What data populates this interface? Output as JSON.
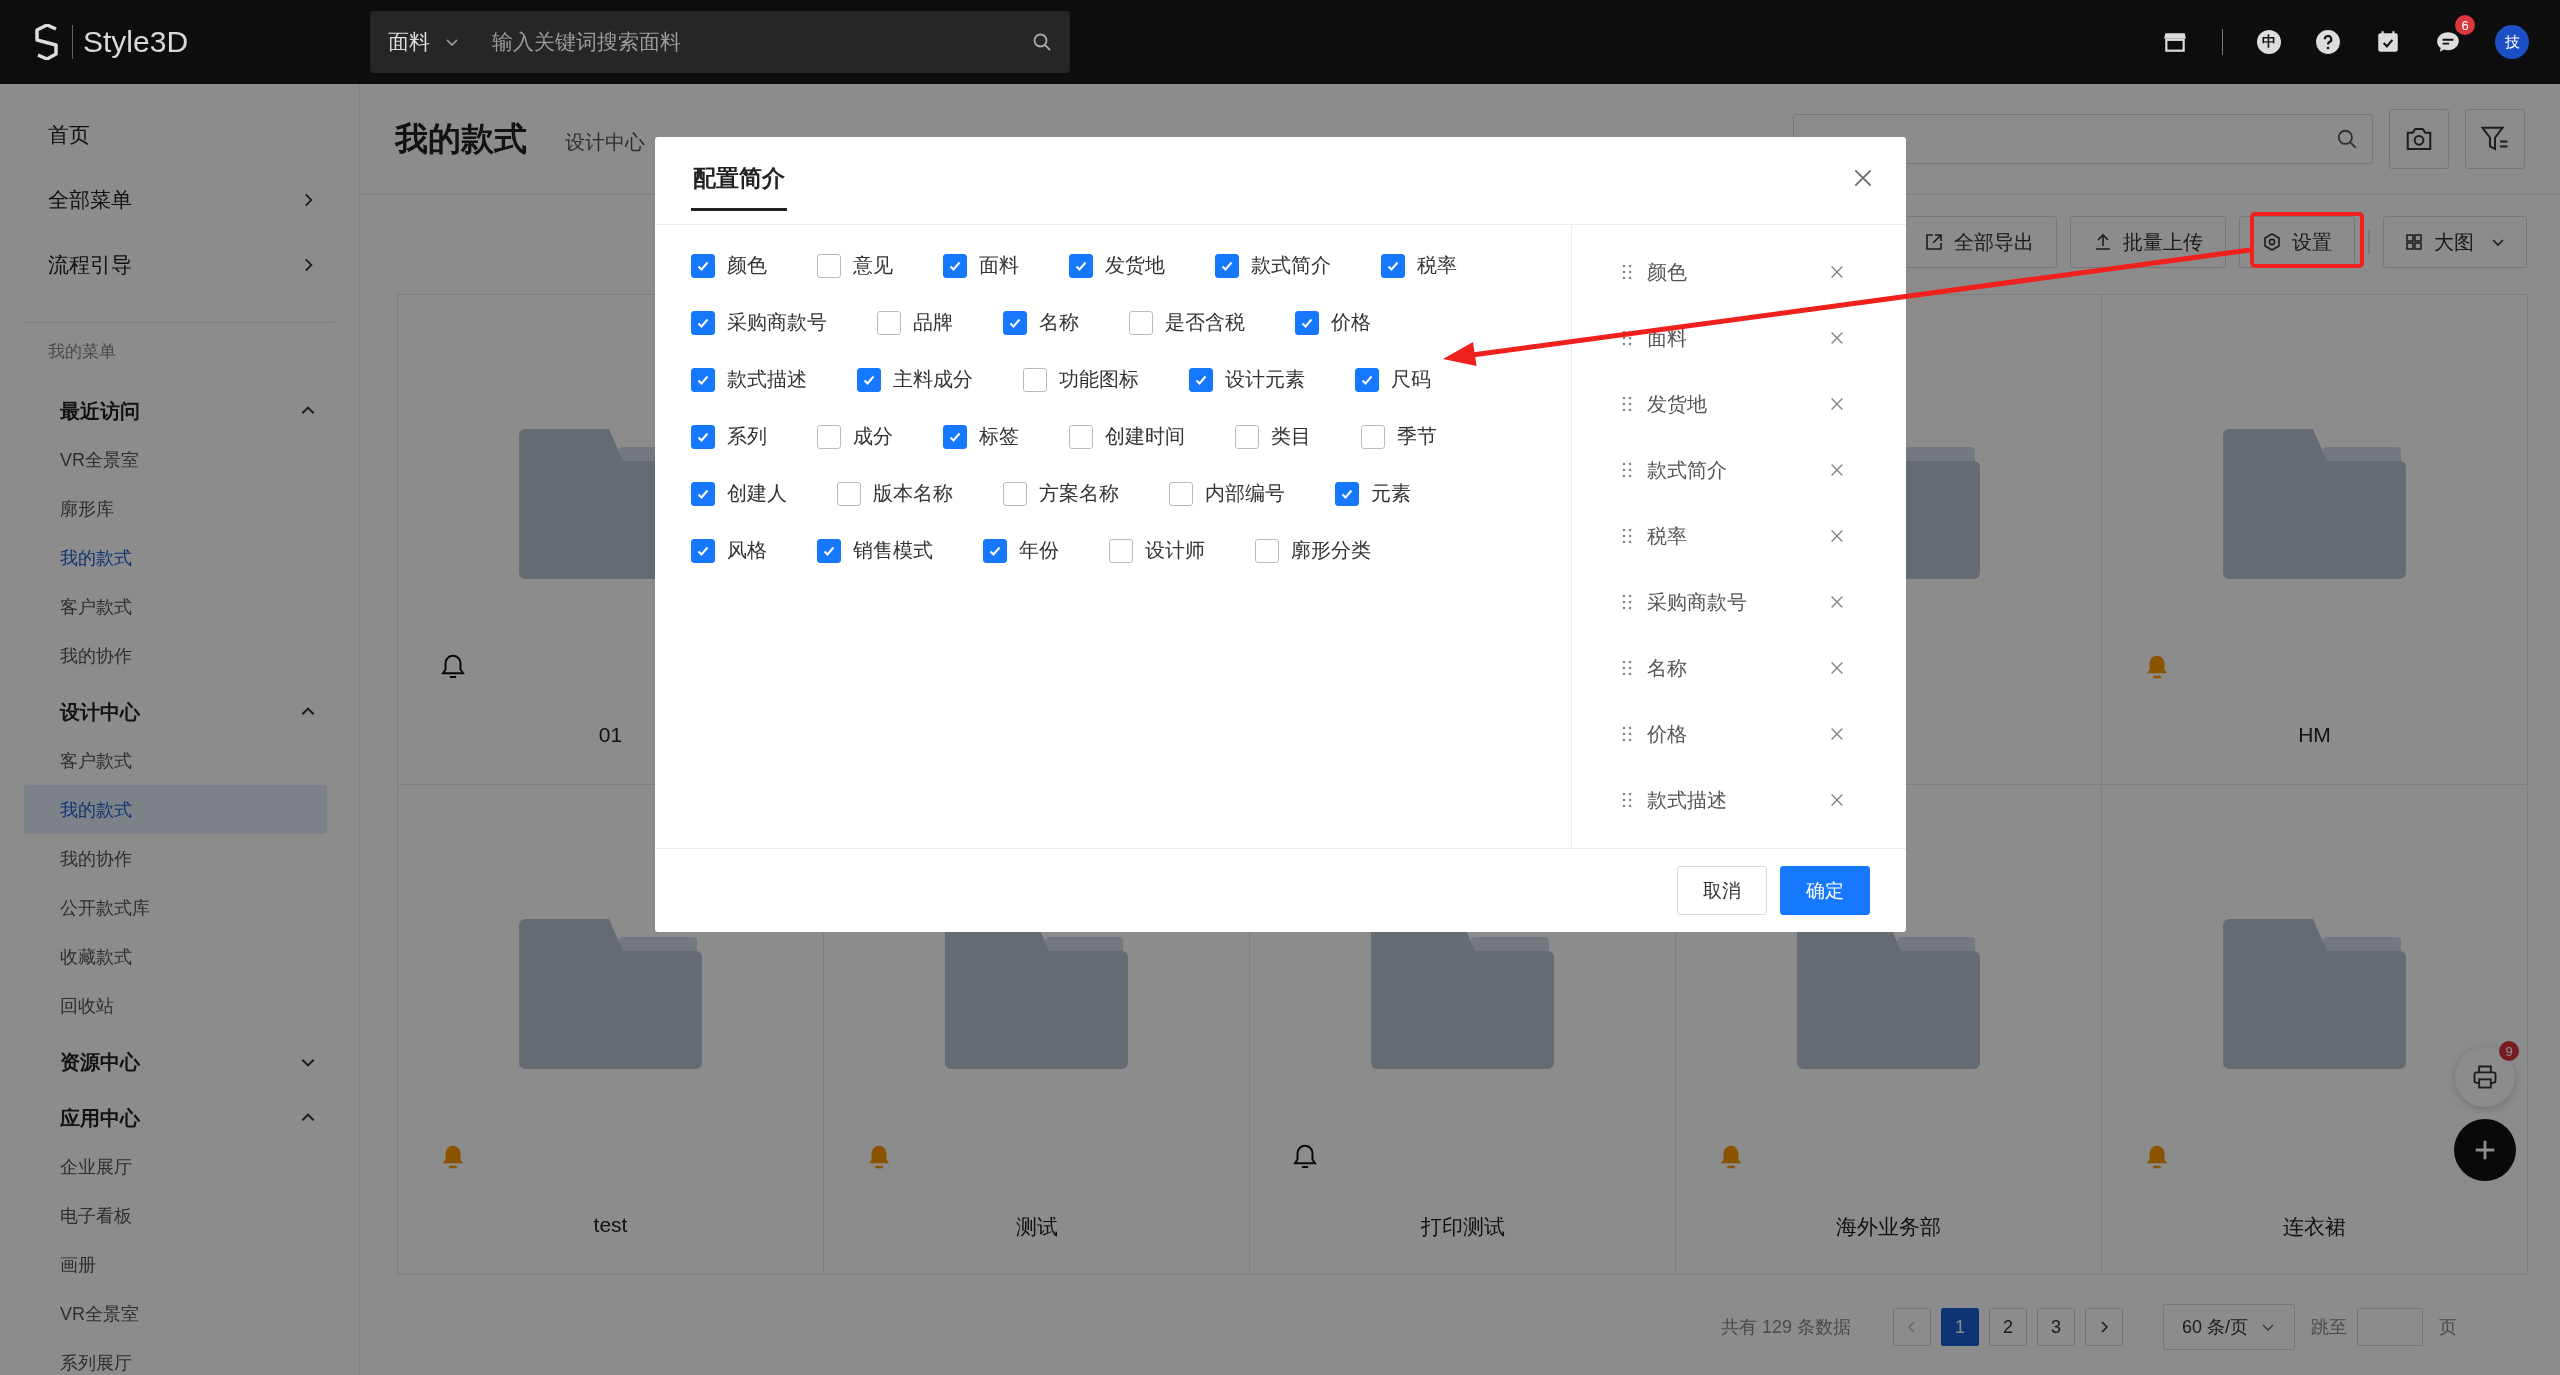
{
  "top_bar": {
    "logo": "Style3D",
    "search": {
      "category": "面料",
      "placeholder": "输入关键词搜索面料"
    },
    "language": "中",
    "chat_badge": "6",
    "avatar": "技"
  },
  "sidebar": {
    "top_items": [
      {
        "label": "首页",
        "arrow": false
      },
      {
        "label": "全部菜单",
        "arrow": true
      },
      {
        "label": "流程引导",
        "arrow": true
      }
    ],
    "section_label": "我的菜单",
    "groups": [
      {
        "label": "最近访问",
        "expanded": true,
        "items": [
          {
            "label": "VR全景室",
            "current": false,
            "selected": false
          },
          {
            "label": "廓形库",
            "current": false,
            "selected": false
          },
          {
            "label": "我的款式",
            "current": true,
            "selected": false
          },
          {
            "label": "客户款式",
            "current": false,
            "selected": false
          },
          {
            "label": "我的协作",
            "current": false,
            "selected": false
          }
        ]
      },
      {
        "label": "设计中心",
        "expanded": true,
        "items": [
          {
            "label": "客户款式",
            "current": false,
            "selected": false
          },
          {
            "label": "我的款式",
            "current": true,
            "selected": true
          },
          {
            "label": "我的协作",
            "current": false,
            "selected": false
          },
          {
            "label": "公开款式库",
            "current": false,
            "selected": false
          },
          {
            "label": "收藏款式",
            "current": false,
            "selected": false
          },
          {
            "label": "回收站",
            "current": false,
            "selected": false
          }
        ]
      },
      {
        "label": "资源中心",
        "expanded": false
      },
      {
        "label": "应用中心",
        "expanded": true,
        "items": [
          {
            "label": "企业展厅",
            "current": false,
            "selected": false
          },
          {
            "label": "电子看板",
            "current": false,
            "selected": false
          },
          {
            "label": "画册",
            "current": false,
            "selected": false
          },
          {
            "label": "VR全景室",
            "current": false,
            "selected": false
          },
          {
            "label": "系列展厅",
            "current": false,
            "selected": false
          }
        ]
      }
    ]
  },
  "page": {
    "title": "我的款式",
    "breadcrumb": "设计中心"
  },
  "toolbar": {
    "buttons": [
      {
        "label": "全部导出",
        "kind": "export"
      },
      {
        "label": "批量上传",
        "kind": "upload"
      },
      {
        "label": "设置",
        "kind": "settings"
      }
    ],
    "view": "大图"
  },
  "cards": [
    {
      "kind": "folder",
      "title": "01",
      "notified": false
    },
    {
      "kind": "blank"
    },
    {
      "kind": "blank"
    },
    {
      "kind": "folder"
    },
    {
      "kind": "folder",
      "title": "HM",
      "notified": true
    },
    {
      "kind": "folder",
      "title": "test",
      "notified": true
    },
    {
      "kind": "folder",
      "title": "测试",
      "notified": true
    },
    {
      "kind": "folder",
      "title": "打印测试",
      "notified": false
    },
    {
      "kind": "folder",
      "title": "海外业务部",
      "notified": true
    },
    {
      "kind": "folder",
      "title": "连衣裙",
      "notified": true
    }
  ],
  "pagination": {
    "summary": "共有 129 条数据",
    "pages": [
      {
        "label": "1",
        "selected": true
      },
      {
        "label": "2",
        "selected": false
      },
      {
        "label": "3",
        "selected": false
      }
    ],
    "page_size": "60 条/页",
    "jump_label": "跳至",
    "page_unit": "页"
  },
  "print_badge": "9",
  "dialog": {
    "title": "配置简介",
    "option_rows": [
      [
        {
          "label": "颜色",
          "checked": true
        },
        {
          "label": "意见",
          "checked": false
        },
        {
          "label": "面料",
          "checked": true
        },
        {
          "label": "发货地",
          "checked": true
        },
        {
          "label": "款式简介",
          "checked": true
        },
        {
          "label": "税率",
          "checked": true
        }
      ],
      [
        {
          "label": "采购商款号",
          "checked": true
        },
        {
          "label": "品牌",
          "checked": false
        },
        {
          "label": "名称",
          "checked": true
        },
        {
          "label": "是否含税",
          "checked": false
        },
        {
          "label": "价格",
          "checked": true
        }
      ],
      [
        {
          "label": "款式描述",
          "checked": true
        },
        {
          "label": "主料成分",
          "checked": true
        },
        {
          "label": "功能图标",
          "checked": false
        },
        {
          "label": "设计元素",
          "checked": true
        },
        {
          "label": "尺码",
          "checked": true
        }
      ],
      [
        {
          "label": "系列",
          "checked": true
        },
        {
          "label": "成分",
          "checked": false
        },
        {
          "label": "标签",
          "checked": true
        },
        {
          "label": "创建时间",
          "checked": false
        },
        {
          "label": "类目",
          "checked": false
        },
        {
          "label": "季节",
          "checked": false
        }
      ],
      [
        {
          "label": "创建人",
          "checked": true
        },
        {
          "label": "版本名称",
          "checked": false
        },
        {
          "label": "方案名称",
          "checked": false
        },
        {
          "label": "内部编号",
          "checked": false
        },
        {
          "label": "元素",
          "checked": true
        }
      ],
      [
        {
          "label": "风格",
          "checked": true
        },
        {
          "label": "销售模式",
          "checked": true
        },
        {
          "label": "年份",
          "checked": true
        },
        {
          "label": "设计师",
          "checked": false
        },
        {
          "label": "廓形分类",
          "checked": false
        }
      ]
    ],
    "selected_fields": [
      "颜色",
      "面料",
      "发货地",
      "款式简介",
      "税率",
      "采购商款号",
      "名称",
      "价格",
      "款式描述"
    ],
    "buttons": [
      {
        "label": "取消",
        "primary": false
      },
      {
        "label": "确定",
        "primary": true
      }
    ]
  }
}
